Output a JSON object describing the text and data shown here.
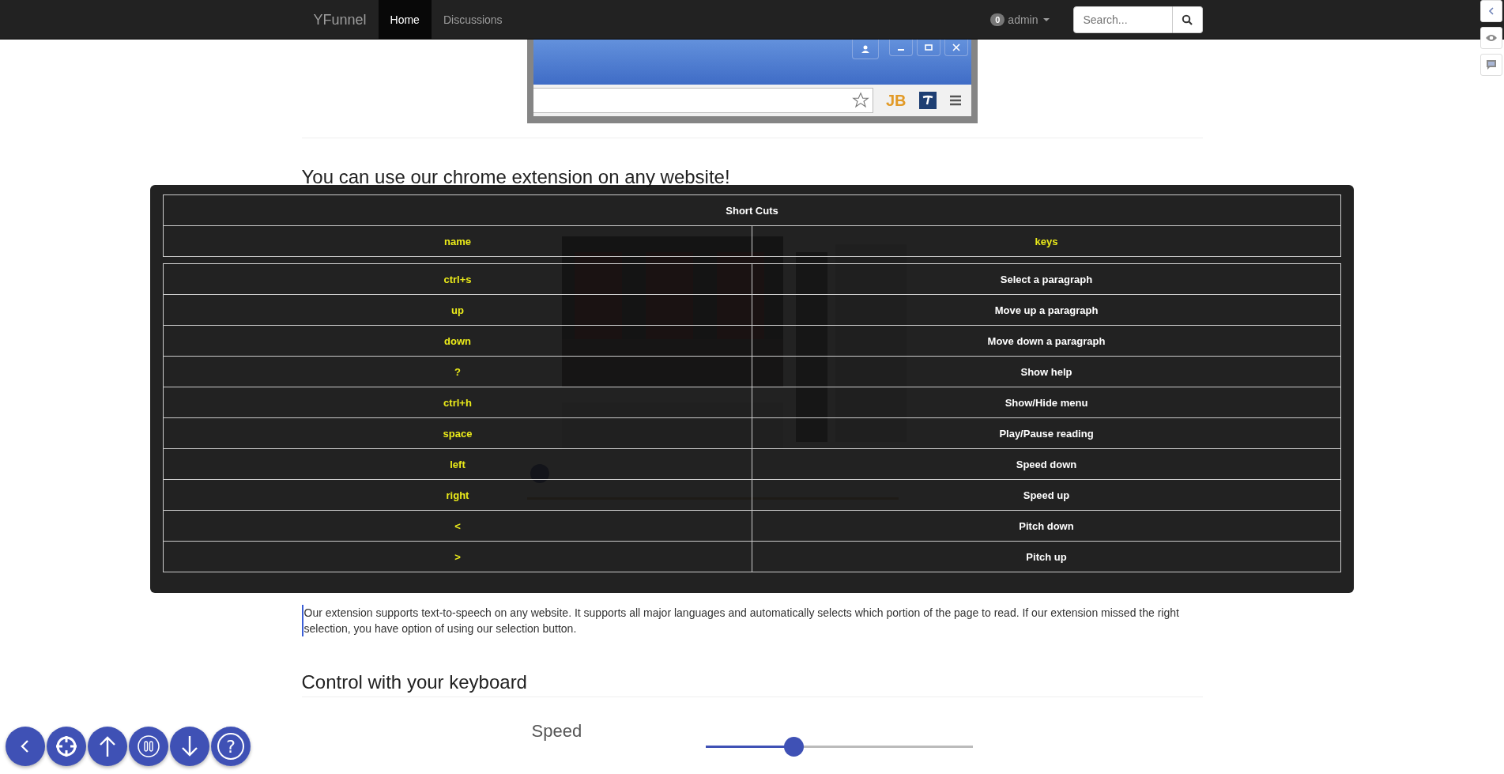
{
  "navbar": {
    "brand": "YFunnel",
    "links": [
      {
        "label": "Home",
        "selected": true
      },
      {
        "label": "Discussions",
        "selected": false
      }
    ],
    "user": {
      "badge": "0",
      "name": "admin"
    },
    "search": {
      "placeholder": "Search..."
    }
  },
  "browser_preview": {
    "extension_label": "JB"
  },
  "heading": "You can use our chrome extension on any website!",
  "paragraph": "Our extension supports text-to-speech on any website. It supports all major languages and automatically selects which portion of the page to read. If our extension missed the right selection, you have option of using our selection button.",
  "keyboard_section": {
    "heading": "Control with your keyboard",
    "slider": {
      "label": "Speed",
      "level": 0.33
    }
  },
  "shortcuts_dialog": {
    "title": "Short Cuts",
    "columns": [
      "name",
      "keys"
    ],
    "rows": [
      {
        "name": "ctrl+s",
        "keys": "Select a paragraph"
      },
      {
        "name": "up",
        "keys": "Move up a paragraph"
      },
      {
        "name": "down",
        "keys": "Move down a paragraph"
      },
      {
        "name": "?",
        "keys": "Show help"
      },
      {
        "name": "ctrl+h",
        "keys": "Show/Hide menu"
      },
      {
        "name": "space",
        "keys": "Play/Pause reading"
      },
      {
        "name": "left",
        "keys": "Speed down"
      },
      {
        "name": "right",
        "keys": "Speed up"
      },
      {
        "name": "<",
        "keys": "Pitch down"
      },
      {
        "name": ">",
        "keys": "Pitch up"
      }
    ]
  },
  "reader_toolbar": {
    "help_glyph": "?"
  }
}
